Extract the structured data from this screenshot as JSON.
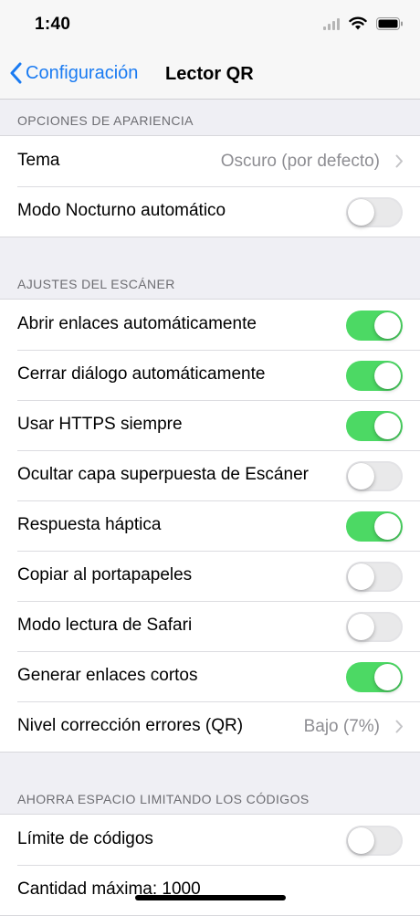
{
  "status_bar": {
    "time": "1:40"
  },
  "nav": {
    "back_label": "Configuración",
    "title": "Lector QR"
  },
  "sections": [
    {
      "header": "OPCIONES DE APARIENCIA",
      "rows": [
        {
          "label": "Tema",
          "value": "Oscuro (por defecto)",
          "type": "disclosure"
        },
        {
          "label": "Modo Nocturno automático",
          "type": "toggle",
          "on": false
        }
      ]
    },
    {
      "header": "AJUSTES DEL ESCÁNER",
      "rows": [
        {
          "label": "Abrir enlaces automáticamente",
          "type": "toggle",
          "on": true
        },
        {
          "label": "Cerrar diálogo automáticamente",
          "type": "toggle",
          "on": true
        },
        {
          "label": "Usar HTTPS siempre",
          "type": "toggle",
          "on": true
        },
        {
          "label": "Ocultar capa superpuesta de Escáner",
          "type": "toggle",
          "on": false
        },
        {
          "label": "Respuesta háptica",
          "type": "toggle",
          "on": true
        },
        {
          "label": "Copiar al portapapeles",
          "type": "toggle",
          "on": false
        },
        {
          "label": "Modo lectura de Safari",
          "type": "toggle",
          "on": false
        },
        {
          "label": "Generar enlaces cortos",
          "type": "toggle",
          "on": true
        },
        {
          "label": "Nivel corrección errores (QR)",
          "value": "Bajo (7%)",
          "type": "disclosure"
        }
      ]
    },
    {
      "header": "AHORRA ESPACIO LIMITANDO LOS CÓDIGOS",
      "rows": [
        {
          "label": "Límite de códigos",
          "type": "toggle",
          "on": false
        },
        {
          "label": "Cantidad máxima:  1000",
          "type": "text"
        }
      ]
    }
  ],
  "colors": {
    "accent": "#1a7bf2",
    "toggle_on": "#4cd964",
    "background": "#efeff4"
  }
}
